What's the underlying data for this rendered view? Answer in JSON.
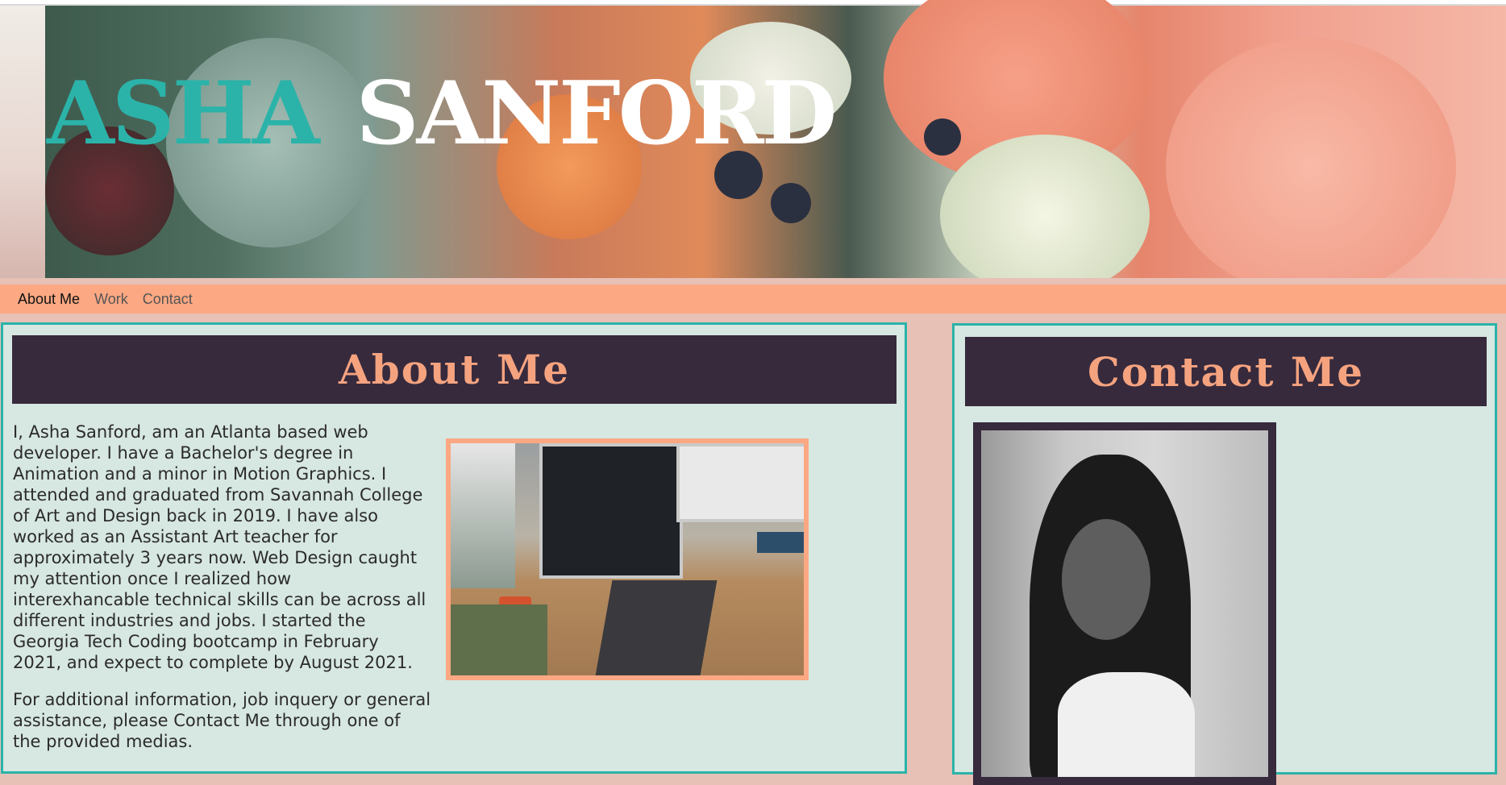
{
  "header": {
    "first_name": "ASHA",
    "last_name": "SANFORD"
  },
  "nav": {
    "items": [
      {
        "label": "About Me"
      },
      {
        "label": "Work"
      },
      {
        "label": "Contact"
      }
    ],
    "active_index": 0
  },
  "about": {
    "heading": "About Me",
    "paragraphs": [
      "I, Asha Sanford, am an Atlanta based web developer. I have a Bachelor's degree in Animation and a minor in Motion Graphics. I attended and graduated from Savannah College of Art and Design back in 2019. I have also worked as an Assistant Art teacher for approximately 3 years now. Web Design caught my attention once I realized how interexhancable technical skills can be across all different industries and jobs. I started the Georgia Tech Coding bootcamp in February 2021, and expect to complete by August 2021.",
      "For additional information, job inquery or general assistance, please Contact Me through one of the provided medias."
    ]
  },
  "contact": {
    "heading": "Contact Me"
  },
  "colors": {
    "teal": "#2bb3a9",
    "peach": "#fba883",
    "plum": "#372a3d",
    "panel_bg": "#d7e7e1",
    "page_bg": "#e7c0b6"
  }
}
